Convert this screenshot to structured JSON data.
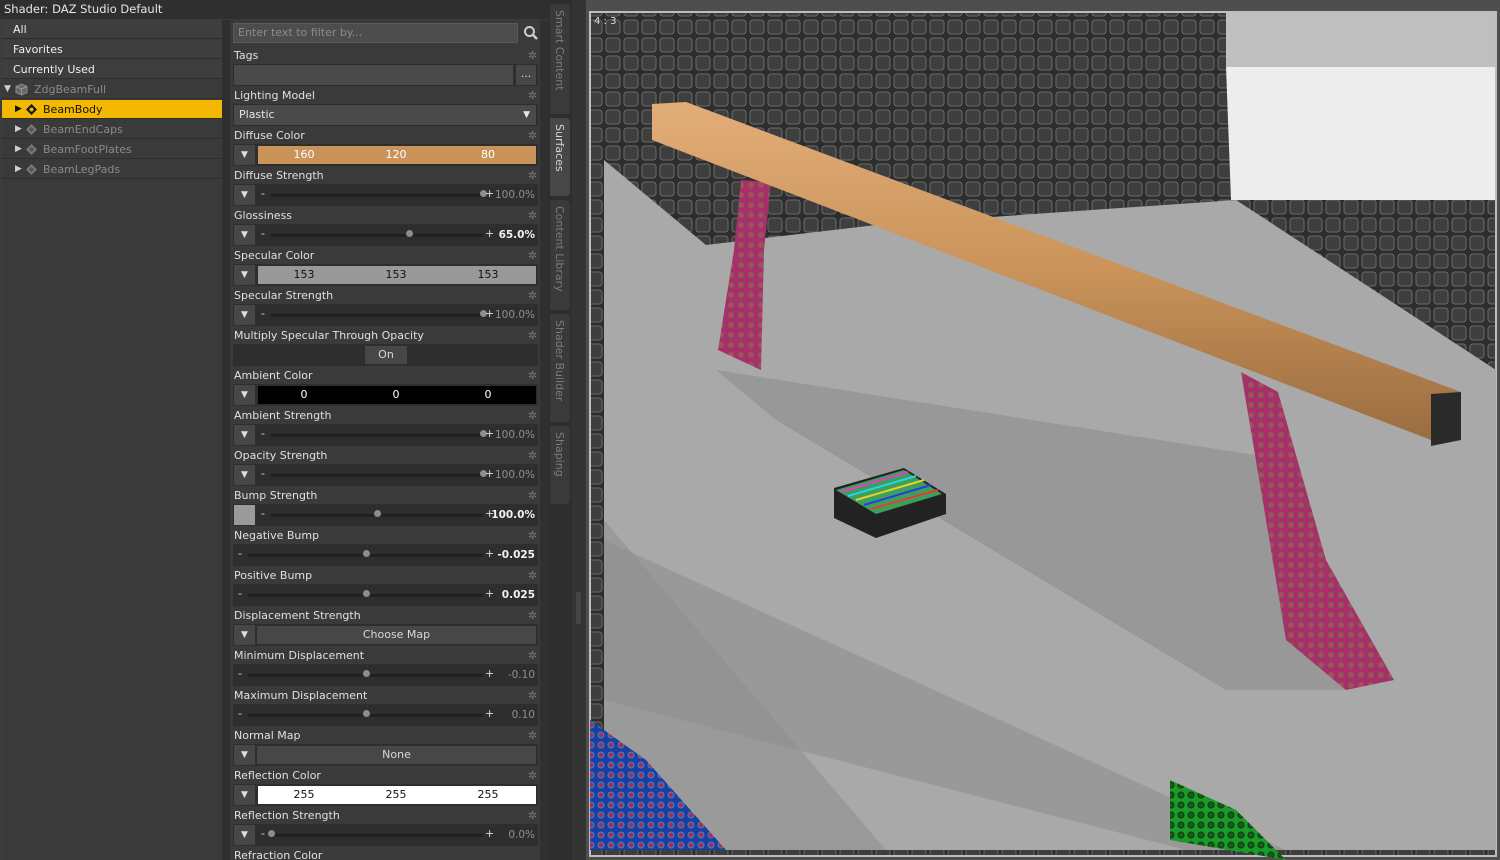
{
  "window": {
    "title": "Shader: DAZ Studio Default"
  },
  "tree": {
    "headers": [
      "All",
      "Favorites",
      "Currently Used"
    ],
    "root": "ZdgBeamFull",
    "items": [
      {
        "label": "BeamBody",
        "selected": true
      },
      {
        "label": "BeamEndCaps",
        "selected": false
      },
      {
        "label": "BeamFootPlates",
        "selected": false
      },
      {
        "label": "BeamLegPads",
        "selected": false
      }
    ]
  },
  "filter": {
    "placeholder": "Enter text to filter by..."
  },
  "properties": {
    "tags": {
      "label": "Tags",
      "button": "..."
    },
    "lighting_model": {
      "label": "Lighting Model",
      "value": "Plastic"
    },
    "diffuse_color": {
      "label": "Diffuse Color",
      "r": "160",
      "g": "120",
      "b": "80",
      "hex": "#c9935a"
    },
    "diffuse_strength": {
      "label": "Diffuse Strength",
      "value": "100.0%",
      "level": 1.0
    },
    "glossiness": {
      "label": "Glossiness",
      "value": "65.0%",
      "level": 0.65
    },
    "specular_color": {
      "label": "Specular Color",
      "r": "153",
      "g": "153",
      "b": "153",
      "hex": "#999999"
    },
    "specular_strength": {
      "label": "Specular Strength",
      "value": "100.0%",
      "level": 1.0
    },
    "multiply_specular": {
      "label": "Multiply Specular Through Opacity",
      "value": "On"
    },
    "ambient_color": {
      "label": "Ambient Color",
      "r": "0",
      "g": "0",
      "b": "0",
      "hex": "#000000"
    },
    "ambient_strength": {
      "label": "Ambient Strength",
      "value": "100.0%",
      "level": 1.0
    },
    "opacity_strength": {
      "label": "Opacity Strength",
      "value": "100.0%",
      "level": 1.0
    },
    "bump_strength": {
      "label": "Bump Strength",
      "value": "100.0%",
      "level": 0.5
    },
    "negative_bump": {
      "label": "Negative Bump",
      "value": "-0.025",
      "level": 0.5
    },
    "positive_bump": {
      "label": "Positive Bump",
      "value": "0.025",
      "level": 0.5
    },
    "displacement_strength": {
      "label": "Displacement Strength",
      "value": "Choose Map"
    },
    "minimum_displacement": {
      "label": "Minimum Displacement",
      "value": "-0.10",
      "level": 0.5
    },
    "maximum_displacement": {
      "label": "Maximum Displacement",
      "value": "0.10",
      "level": 0.5
    },
    "normal_map": {
      "label": "Normal Map",
      "value": "None"
    },
    "reflection_color": {
      "label": "Reflection Color",
      "r": "255",
      "g": "255",
      "b": "255",
      "hex": "#ffffff"
    },
    "reflection_strength": {
      "label": "Reflection Strength",
      "value": "0.0%",
      "level": 0.0
    },
    "refraction_color": {
      "label": "Refraction Color"
    }
  },
  "side_tabs": [
    {
      "label": "Smart Content",
      "active": false
    },
    {
      "label": "Surfaces",
      "active": true
    },
    {
      "label": "Content Library",
      "active": false
    },
    {
      "label": "Shader Builder",
      "active": false
    },
    {
      "label": "Shaping",
      "active": false
    }
  ],
  "viewport": {
    "aspect": "4 : 3"
  },
  "colors": {
    "selection": "#f5b800",
    "beam": "#c9935a",
    "legs": "#b03060"
  },
  "icons": [
    "search-icon",
    "gear-icon",
    "chevron-down-icon",
    "expand-arrow-icon",
    "figure-icon",
    "material-icon"
  ]
}
